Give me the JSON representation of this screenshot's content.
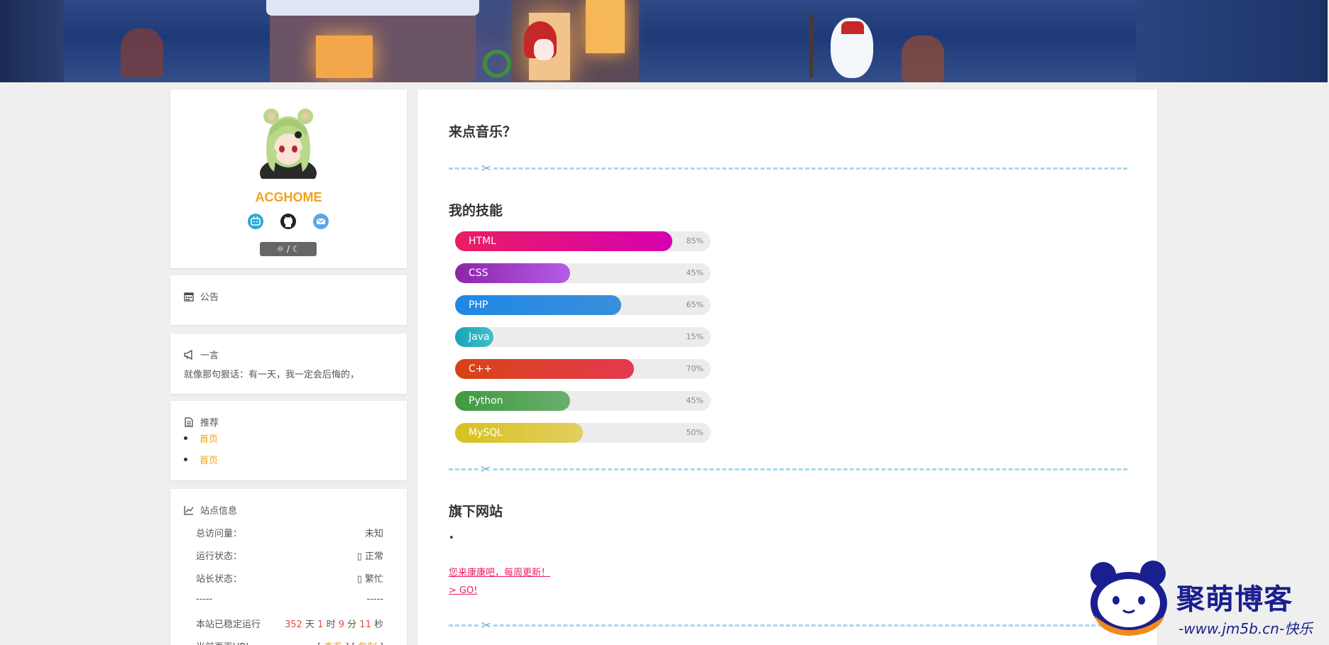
{
  "profile": {
    "site_name": "ACGHOME",
    "theme_toggle": "☼ / ☾",
    "social_icons": [
      "bilibili-icon",
      "github-icon",
      "mail-icon"
    ]
  },
  "announcement": {
    "title": "公告",
    "icon": "calendar-icon"
  },
  "hitokoto": {
    "title": "一言",
    "icon": "megaphone-icon",
    "text": "就像那句狠话：有一天，我一定会后悔的，"
  },
  "recommend": {
    "title": "推荐",
    "icon": "document-icon",
    "items": [
      "首页",
      "首页"
    ]
  },
  "site_info": {
    "title": "站点信息",
    "icon": "line-chart-icon",
    "rows": [
      {
        "label": "总访问量：",
        "value": "未知"
      },
      {
        "label": "运行状态：",
        "value": "▯ 正常"
      },
      {
        "label": "站长状态：",
        "value": "▯ 繁忙"
      },
      {
        "label": "-----",
        "value": "-----"
      }
    ],
    "uptime": {
      "label": "本站已稳定运行",
      "days": "352",
      "days_unit": "天",
      "hours": "1",
      "hours_unit": "时",
      "minutes": "9",
      "minutes_unit": "分",
      "seconds": "11",
      "seconds_unit": "秒"
    },
    "url_row": {
      "label": "当前页面URL",
      "value_open": "[",
      "action1": "查看",
      "sep": "] [",
      "action2": "复制",
      "value_close": "]"
    }
  },
  "main": {
    "music_title": "来点音乐？",
    "skills_title": "我的技能",
    "skills": [
      {
        "name": "HTML",
        "percent": 85,
        "label": "85%",
        "from": "#e91e63",
        "to": "#d500b0"
      },
      {
        "name": "CSS",
        "percent": 45,
        "label": "45%",
        "from": "#8e24aa",
        "to": "#b45de6"
      },
      {
        "name": "PHP",
        "percent": 65,
        "label": "65%",
        "from": "#1e88e5",
        "to": "#3a8edb"
      },
      {
        "name": "Java",
        "percent": 15,
        "label": "15%",
        "from": "#1aa3b8",
        "to": "#3cc0c9"
      },
      {
        "name": "C++",
        "percent": 70,
        "label": "70%",
        "from": "#d84315",
        "to": "#e53950"
      },
      {
        "name": "Python",
        "percent": 45,
        "label": "45%",
        "from": "#3f9a3f",
        "to": "#6aaf6e"
      },
      {
        "name": "MySQL",
        "percent": 50,
        "label": "50%",
        "from": "#d6c21e",
        "to": "#e2ce5e"
      }
    ],
    "sites_title": "旗下网站",
    "sites_bullet": "•",
    "site_link": "您来康康吧，每周更新！",
    "go_link": "> GO!"
  },
  "watermark": {
    "brand": "聚萌博客",
    "url": "-www.jm5b.cn-快乐"
  },
  "colors": {
    "accent": "#f2a11b",
    "link": "#e91e63",
    "divider": "#a8d8ee"
  }
}
